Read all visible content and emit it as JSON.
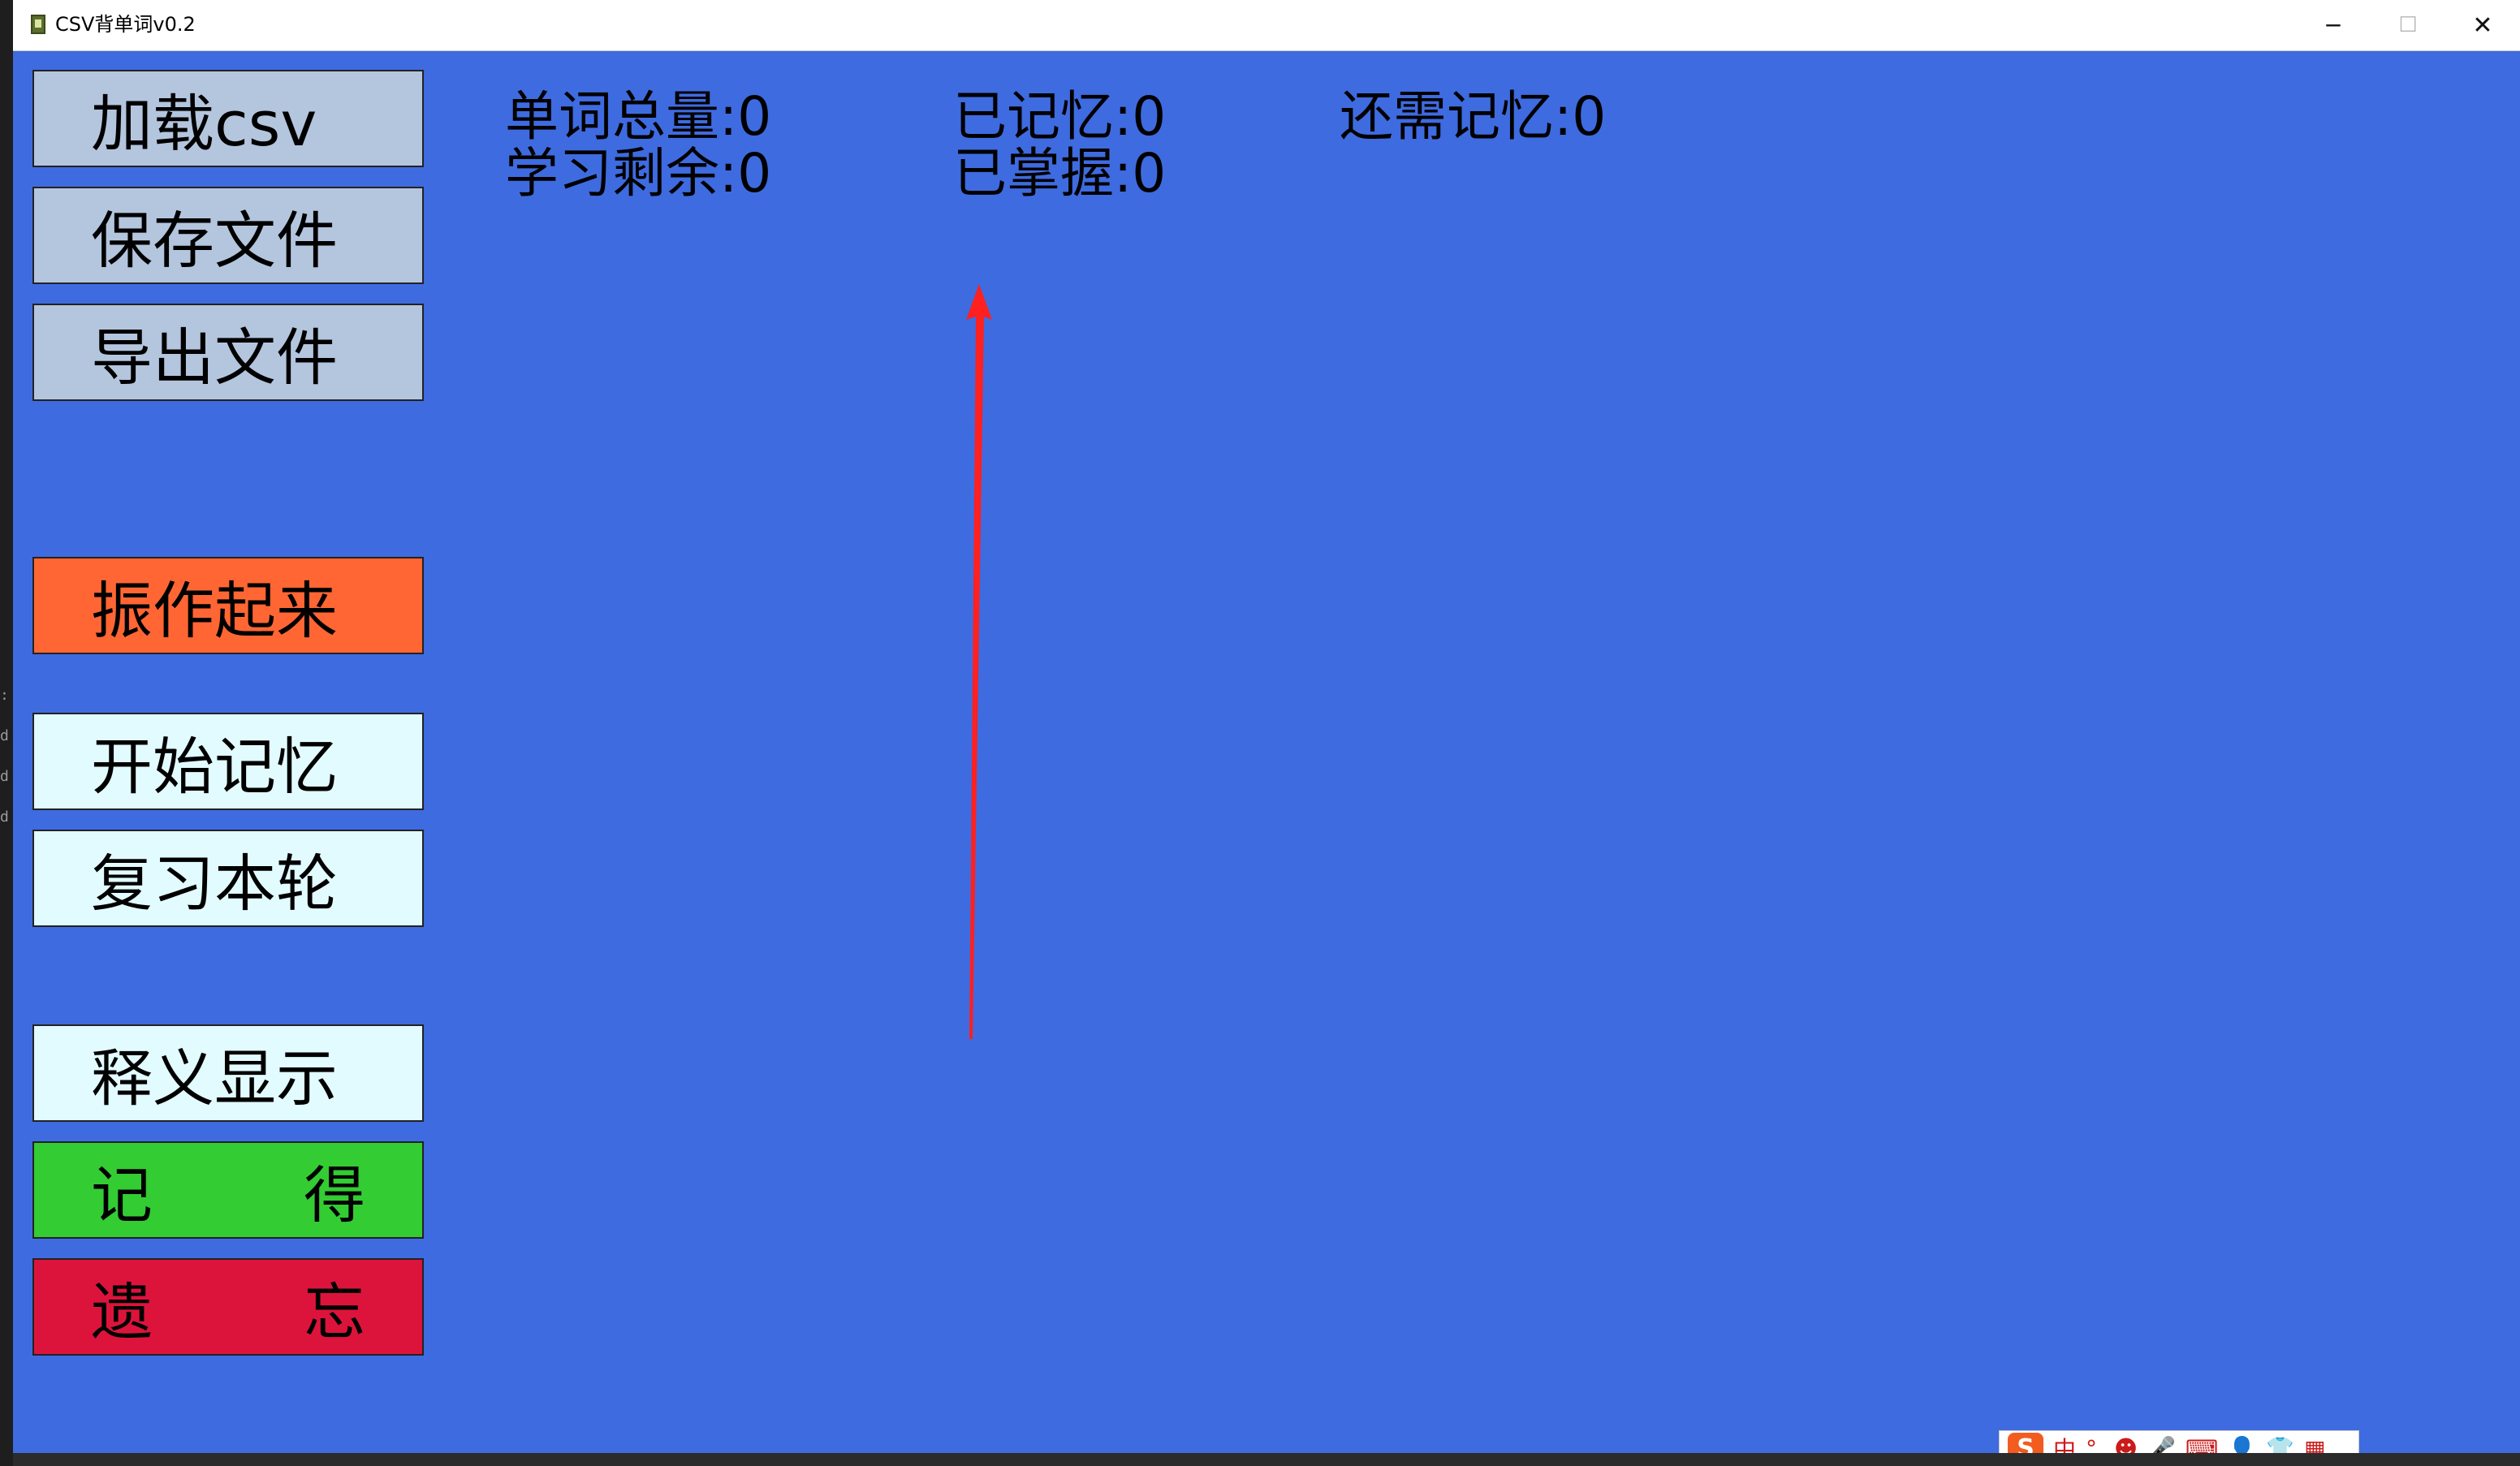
{
  "window": {
    "title": "CSV背单词v0.2",
    "minimize": "─",
    "maximize": "☐",
    "close": "✕"
  },
  "sidebar": {
    "load_csv": "加载csv",
    "save_file": "保存文件",
    "export_file": "导出文件",
    "cheer_up": "振作起来",
    "start_memorize": "开始记忆",
    "review_round": "复习本轮",
    "show_meaning": "释义显示",
    "remember_left": "记",
    "remember_right": "得",
    "forget_left": "遗",
    "forget_right": "忘"
  },
  "stats": {
    "total_words": "单词总量:0",
    "memorized": "已记忆:0",
    "remaining_to_memorize": "还需记忆:0",
    "study_remaining": "学习剩余:0",
    "mastered": "已掌握:0"
  },
  "ime": {
    "logo": "S",
    "mode": "中",
    "punct": "°,",
    "emoji": "☻",
    "mic": "🎤",
    "keyboard": "⌨",
    "user": "👤",
    "skin": "👕",
    "apps": "▦"
  },
  "colors": {
    "background": "#3f6be0",
    "light_button": "#b4c5de",
    "orange_button": "#ff6633",
    "cyan_button": "#e2fbff",
    "green_button": "#33cc33",
    "red_button": "#dc143c",
    "annotation_arrow": "#ff2020"
  }
}
